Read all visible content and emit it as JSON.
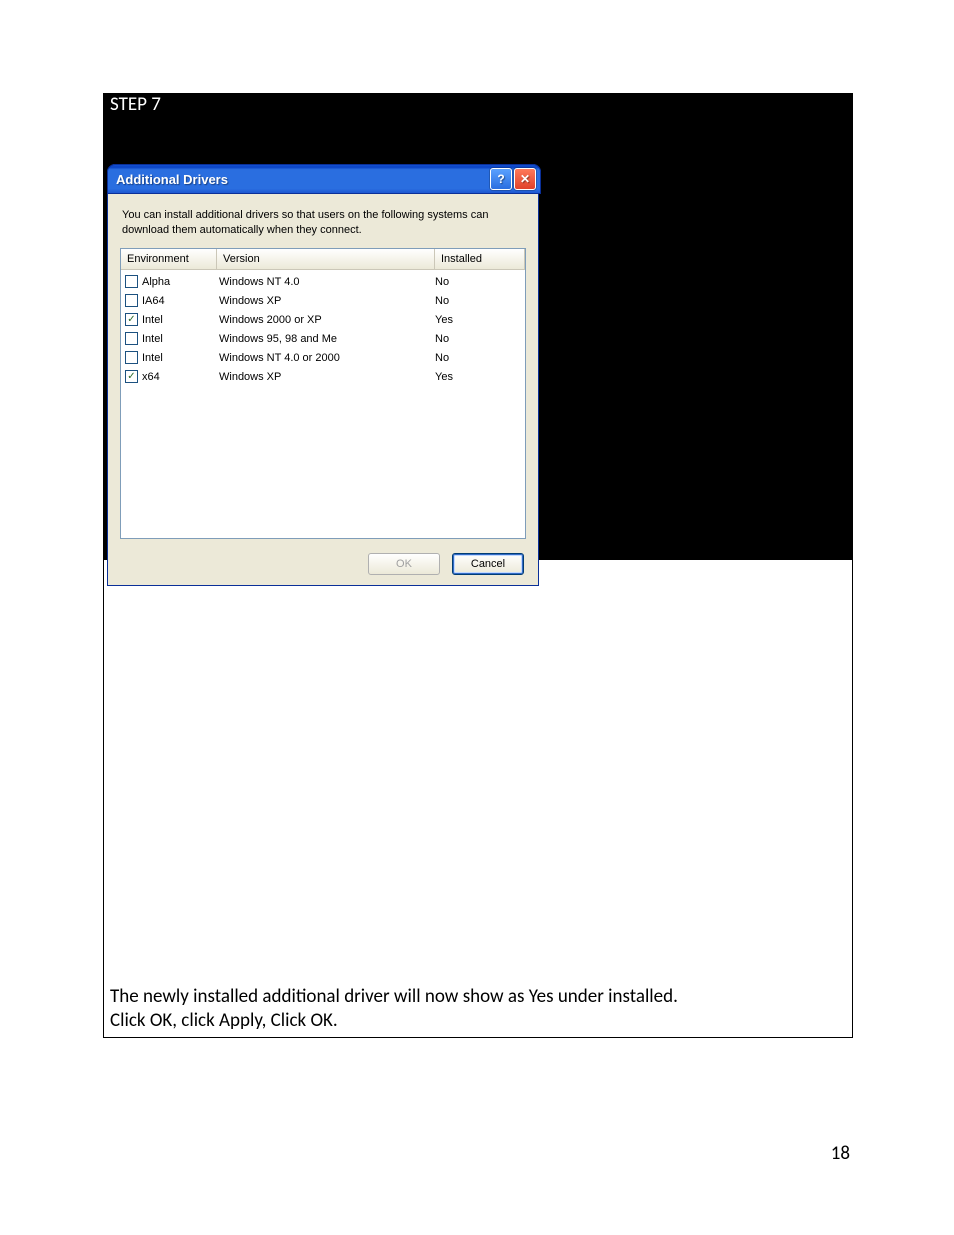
{
  "step_label": "STEP 7",
  "dialog": {
    "title": "Additional Drivers",
    "description": "You can install additional drivers so that users on the following systems can download them automatically when they connect.",
    "columns": {
      "environment": "Environment",
      "version": "Version",
      "installed": "Installed"
    },
    "rows": [
      {
        "checked": false,
        "environment": "Alpha",
        "version": "Windows NT 4.0",
        "installed": "No"
      },
      {
        "checked": false,
        "environment": "IA64",
        "version": "Windows XP",
        "installed": "No"
      },
      {
        "checked": true,
        "environment": "Intel",
        "version": "Windows 2000 or XP",
        "installed": "Yes"
      },
      {
        "checked": false,
        "environment": "Intel",
        "version": "Windows 95, 98 and Me",
        "installed": "No"
      },
      {
        "checked": false,
        "environment": "Intel",
        "version": "Windows NT 4.0 or 2000",
        "installed": "No"
      },
      {
        "checked": true,
        "environment": "x64",
        "version": "Windows XP",
        "installed": "Yes"
      }
    ],
    "buttons": {
      "ok": "OK",
      "cancel": "Cancel"
    }
  },
  "caption": {
    "line1": "The newly installed additional driver will now show as Yes under installed.",
    "line2": "Click OK, click Apply, Click OK."
  },
  "page_number": "18",
  "icons": {
    "help": "?",
    "close": "✕",
    "check": "✓"
  }
}
